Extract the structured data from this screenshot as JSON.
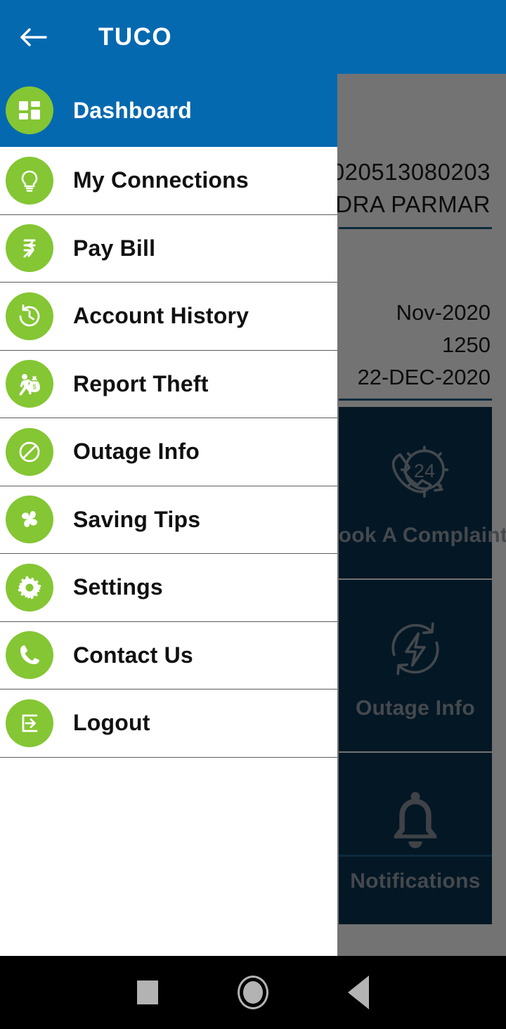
{
  "appbar": {
    "title": "TUCO",
    "back_icon": "arrow-left-icon"
  },
  "background": {
    "account_number": "020513080203",
    "account_name": "ENDRA PARMAR",
    "bill_month": "Nov-2020",
    "bill_amount": "1250",
    "bill_due_date": "22-DEC-2020",
    "tiles": [
      {
        "label": "Book A Complaint",
        "icon": "phone-24-support-icon"
      },
      {
        "label": "Outage Info",
        "icon": "power-outage-refresh-icon"
      },
      {
        "label": "Notifications",
        "icon": "bell-icon"
      }
    ]
  },
  "drawer": {
    "items": [
      {
        "label": "Dashboard",
        "icon": "dashboard-grid-icon",
        "active": true
      },
      {
        "label": "My Connections",
        "icon": "lightbulb-icon",
        "active": false
      },
      {
        "label": "Pay Bill",
        "icon": "rupee-icon",
        "active": false
      },
      {
        "label": "Account History",
        "icon": "clock-history-icon",
        "active": false
      },
      {
        "label": "Report Theft",
        "icon": "thief-money-bag-icon",
        "active": false
      },
      {
        "label": "Outage Info",
        "icon": "no-entry-icon",
        "active": false
      },
      {
        "label": "Saving Tips",
        "icon": "fan-pinwheel-icon",
        "active": false
      },
      {
        "label": "Settings",
        "icon": "gear-icon",
        "active": false
      },
      {
        "label": "Contact Us",
        "icon": "phone-handset-icon",
        "active": false
      },
      {
        "label": "Logout",
        "icon": "logout-arrow-icon",
        "active": false
      }
    ]
  },
  "navbar": {
    "recents_icon": "square-recents-icon",
    "home_icon": "circle-home-icon",
    "back_icon": "triangle-back-icon"
  },
  "colors": {
    "header_blue": "#0569b0",
    "accent_green": "#84c633",
    "tile_navy": "#0a3353",
    "divider_blue": "#1b5d86"
  }
}
